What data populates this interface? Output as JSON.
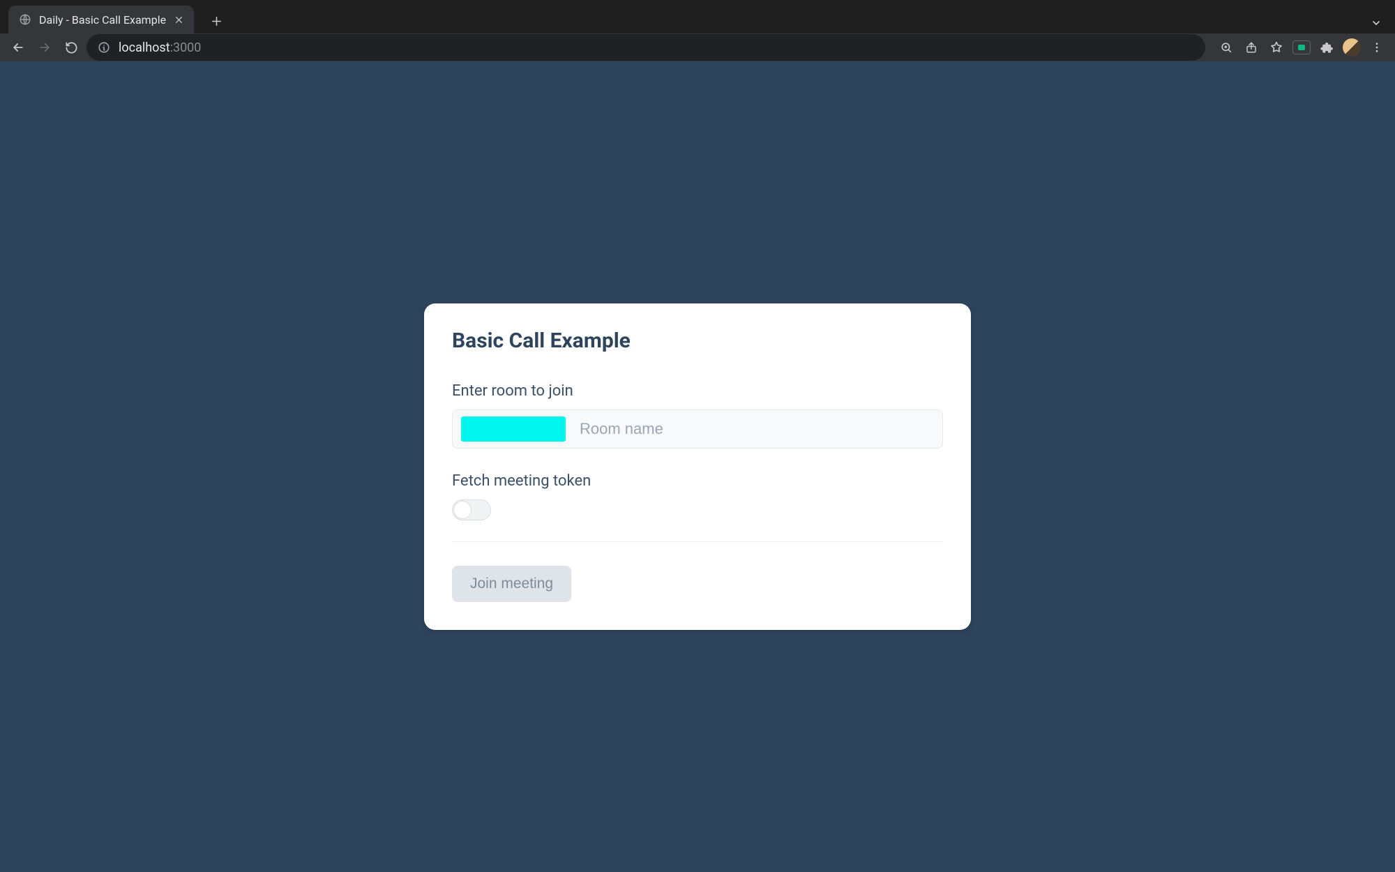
{
  "browser": {
    "tab_title": "Daily - Basic Call Example",
    "url_host": "localhost",
    "url_port": ":3000"
  },
  "card": {
    "title": "Basic Call Example",
    "room_label": "Enter room to join",
    "room_placeholder": "Room name",
    "room_value": "",
    "token_label": "Fetch meeting token",
    "token_toggle_on": false,
    "join_label": "Join meeting",
    "join_enabled": false
  }
}
